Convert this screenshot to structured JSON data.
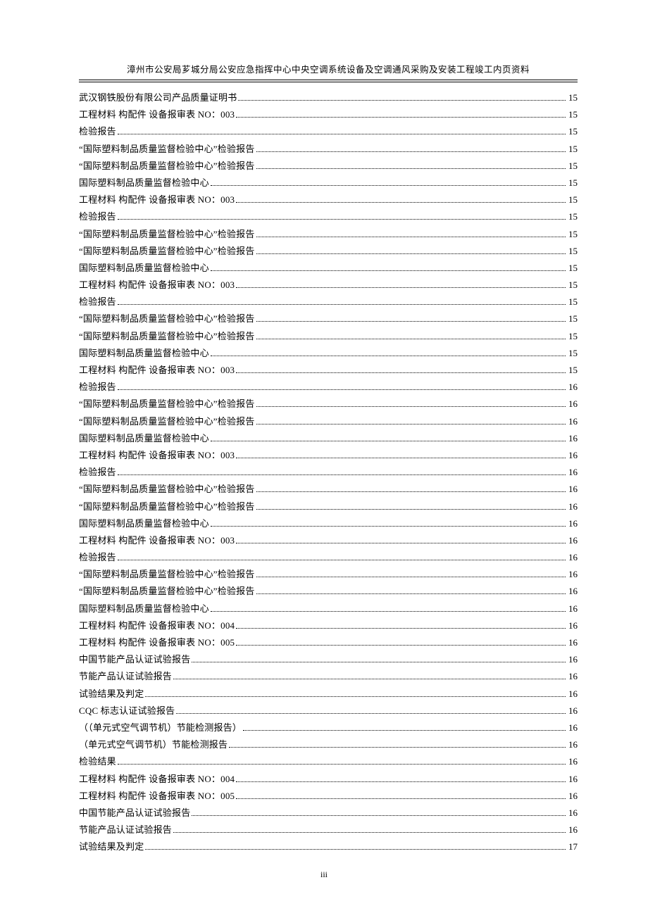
{
  "header": {
    "title": "漳州市公安局芗城分局公安应急指挥中心中央空调系统设备及空调通风采购及安装工程竣工内页资料"
  },
  "footer": {
    "page_number": "iii"
  },
  "toc": [
    {
      "label": "武汉钢铁股份有限公司产品质量证明书",
      "page": "15"
    },
    {
      "label": "工程材料   构配件  设备报审表        NO：003",
      "page": "15"
    },
    {
      "label": "检验报告",
      "page": "15"
    },
    {
      "label": "“国际塑料制品质量监督检验中心”检验报告",
      "page": "15"
    },
    {
      "label": "“国际塑料制品质量监督检验中心”检验报告",
      "page": "15"
    },
    {
      "label": "国际塑料制品质量监督检验中心",
      "page": "15"
    },
    {
      "label": "工程材料   构配件  设备报审表        NO：003",
      "page": "15"
    },
    {
      "label": "检验报告",
      "page": "15"
    },
    {
      "label": "“国际塑料制品质量监督检验中心”检验报告",
      "page": "15"
    },
    {
      "label": "“国际塑料制品质量监督检验中心”检验报告",
      "page": "15"
    },
    {
      "label": "国际塑料制品质量监督检验中心",
      "page": "15"
    },
    {
      "label": "工程材料   构配件  设备报审表        NO：003",
      "page": "15"
    },
    {
      "label": "检验报告",
      "page": "15"
    },
    {
      "label": "“国际塑料制品质量监督检验中心”检验报告",
      "page": "15"
    },
    {
      "label": "“国际塑料制品质量监督检验中心”检验报告",
      "page": "15"
    },
    {
      "label": "国际塑料制品质量监督检验中心",
      "page": "15"
    },
    {
      "label": "工程材料   构配件  设备报审表        NO：003",
      "page": "15"
    },
    {
      "label": "检验报告",
      "page": "16"
    },
    {
      "label": "“国际塑料制品质量监督检验中心”检验报告",
      "page": "16"
    },
    {
      "label": "“国际塑料制品质量监督检验中心”检验报告",
      "page": "16"
    },
    {
      "label": "国际塑料制品质量监督检验中心",
      "page": "16"
    },
    {
      "label": "工程材料   构配件  设备报审表        NO：003",
      "page": "16"
    },
    {
      "label": "检验报告",
      "page": "16"
    },
    {
      "label": "“国际塑料制品质量监督检验中心”检验报告",
      "page": "16"
    },
    {
      "label": "“国际塑料制品质量监督检验中心”检验报告",
      "page": "16"
    },
    {
      "label": "国际塑料制品质量监督检验中心",
      "page": "16"
    },
    {
      "label": "工程材料   构配件  设备报审表        NO：003",
      "page": "16"
    },
    {
      "label": "检验报告",
      "page": "16"
    },
    {
      "label": "“国际塑料制品质量监督检验中心”检验报告",
      "page": "16"
    },
    {
      "label": "“国际塑料制品质量监督检验中心”检验报告",
      "page": "16"
    },
    {
      "label": "国际塑料制品质量监督检验中心",
      "page": "16"
    },
    {
      "label": "工程材料   构配件  设备报审表        NO：004",
      "page": "16"
    },
    {
      "label": "工程材料   构配件  设备报审表        NO：005",
      "page": "16"
    },
    {
      "label": "中国节能产品认证试验报告",
      "page": "16"
    },
    {
      "label": "节能产品认证试验报告",
      "page": "16"
    },
    {
      "label": "试验结果及判定",
      "page": "16"
    },
    {
      "label": "CQC 标志认证试验报告",
      "page": "16"
    },
    {
      "label": "（（单元式空气调节机）节能检测报告）",
      "page": "16"
    },
    {
      "label": "（单元式空气调节机）节能检测报告",
      "page": "16"
    },
    {
      "label": "检验结果",
      "page": "16"
    },
    {
      "label": "工程材料   构配件  设备报审表        NO：004",
      "page": "16"
    },
    {
      "label": "工程材料   构配件  设备报审表        NO：005",
      "page": "16"
    },
    {
      "label": "中国节能产品认证试验报告",
      "page": "16"
    },
    {
      "label": "节能产品认证试验报告",
      "page": "16"
    },
    {
      "label": "试验结果及判定",
      "page": "17"
    }
  ]
}
